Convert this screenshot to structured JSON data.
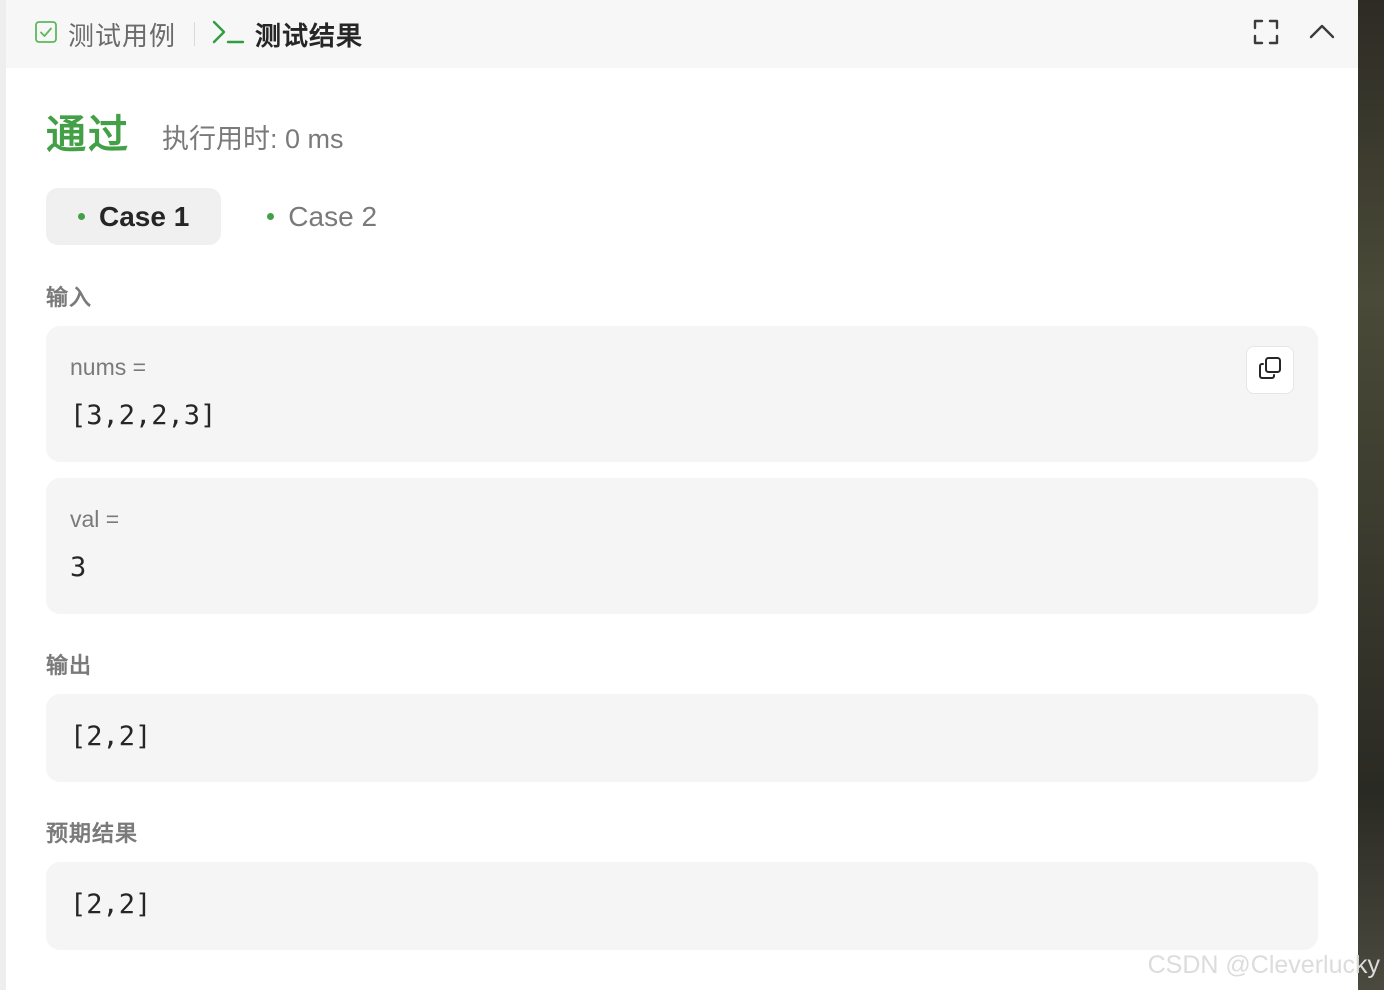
{
  "tabs": {
    "testcases_label": "测试用例",
    "results_label": "测试结果"
  },
  "result": {
    "status": "通过",
    "runtime": "执行用时: 0 ms"
  },
  "cases": [
    {
      "label": "Case 1",
      "active": true
    },
    {
      "label": "Case 2",
      "active": false
    }
  ],
  "input": {
    "label": "输入",
    "params": [
      {
        "name": "nums =",
        "value": "[3,2,2,3]"
      },
      {
        "name": "val =",
        "value": "3"
      }
    ]
  },
  "output": {
    "label": "输出",
    "value": "[2,2]"
  },
  "expected": {
    "label": "预期结果",
    "value": "[2,2]"
  },
  "watermark": "CSDN @Cleverlucky",
  "colors": {
    "accent_green": "#43a047",
    "box_bg": "#f5f5f5",
    "tabbar_bg": "#f7f7f7"
  },
  "icons": {
    "testcases_tab": "checkbox-icon",
    "results_tab": "terminal-icon",
    "fullscreen": "fullscreen-icon",
    "collapse": "chevron-up-icon",
    "copy": "copy-icon"
  }
}
